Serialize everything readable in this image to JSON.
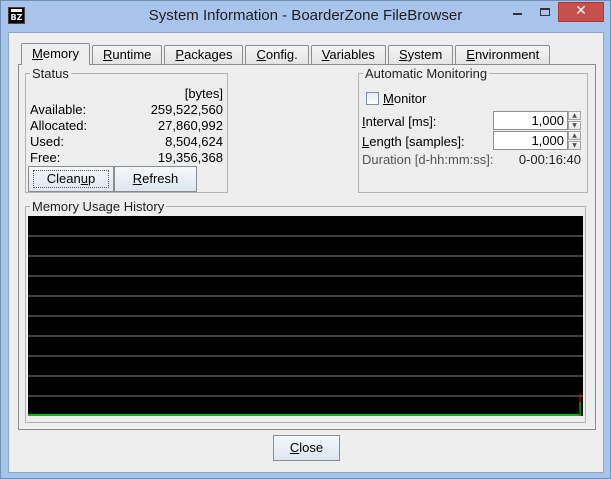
{
  "window": {
    "title": "System Information - BoarderZone FileBrowser",
    "icon_text": "BZ",
    "close_glyph": "✕"
  },
  "tabs": [
    {
      "label": "Memory",
      "active": true
    },
    {
      "label": "Runtime",
      "active": false
    },
    {
      "label": "Packages",
      "active": false
    },
    {
      "label": "Config.",
      "active": false
    },
    {
      "label": "Variables",
      "active": false
    },
    {
      "label": "System",
      "active": false
    },
    {
      "label": "Environment",
      "active": false
    }
  ],
  "status": {
    "title": "Status",
    "unit": "[bytes]",
    "rows": [
      {
        "label": "Available:",
        "value": "259,522,560"
      },
      {
        "label": "Allocated:",
        "value": "27,860,992"
      },
      {
        "label": "Used:",
        "value": "8,504,624"
      },
      {
        "label": "Free:",
        "value": "19,356,368"
      }
    ],
    "cleanup_label": "Cleanup",
    "refresh_label": "Refresh"
  },
  "monitoring": {
    "title": "Automatic Monitoring",
    "monitor_label": "Monitor",
    "monitor_checked": false,
    "interval_label": "Interval [ms]:",
    "interval_value": "1,000",
    "length_label": "Length [samples]:",
    "length_value": "1,000",
    "duration_label": "Duration [d-hh:mm:ss]:",
    "duration_value": "0-00:16:40"
  },
  "history": {
    "title": "Memory Usage History",
    "gridline_count": 9,
    "line_color": "#00ff00",
    "marker_color": "#ff0000"
  },
  "footer": {
    "close_label": "Close"
  },
  "colors": {
    "titlebar": "#a9c4ea",
    "close_button": "#c7504c",
    "panel": "#eeeeee",
    "graph_bg": "#000000"
  }
}
